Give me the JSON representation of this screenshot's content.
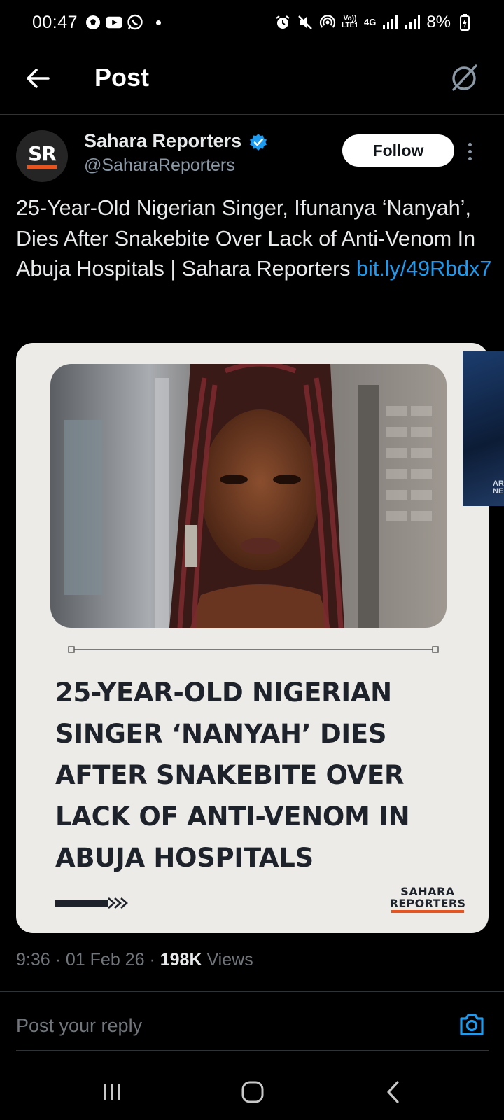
{
  "status_bar": {
    "time": "00:47",
    "battery": "8%",
    "volte": "Vo)) LTE1",
    "network": "4G"
  },
  "header": {
    "title": "Post"
  },
  "post": {
    "author_name": "Sahara Reporters",
    "author_handle": "@SaharaReporters",
    "avatar_text": "SR",
    "follow_label": "Follow",
    "text": "25-Year-Old Nigerian Singer, Ifunanya ‘Nanyah’, Dies After Snakebite Over Lack of Anti-Venom In Abuja Hospitals | Sahara Reporters ",
    "link": "bit.ly/49Rbdx7",
    "media": {
      "headline": "25-YEAR-OLD NIGERIAN SINGER ‘NANYAH’ DIES AFTER SNAKEBITE OVER LACK OF ANTI-VENOM IN ABUJA HOSPITALS",
      "logo_line1": "SAHARA",
      "logo_line2": "REPORTERS",
      "next_tag": "AR NE"
    },
    "time": "9:36",
    "date": "01 Feb 26",
    "views_count": "198K",
    "views_label": "Views"
  },
  "reply": {
    "placeholder": "Post your reply"
  },
  "colors": {
    "accent": "#1d9bf0",
    "brand_orange": "#e8541f",
    "background": "#000000"
  },
  "icons": {
    "back": "arrow-left-icon",
    "grok": "grok-icon",
    "verified": "verified-badge-icon",
    "camera": "camera-icon",
    "nav_recents": "recents-icon",
    "nav_home": "home-icon",
    "nav_back": "nav-back-icon"
  }
}
